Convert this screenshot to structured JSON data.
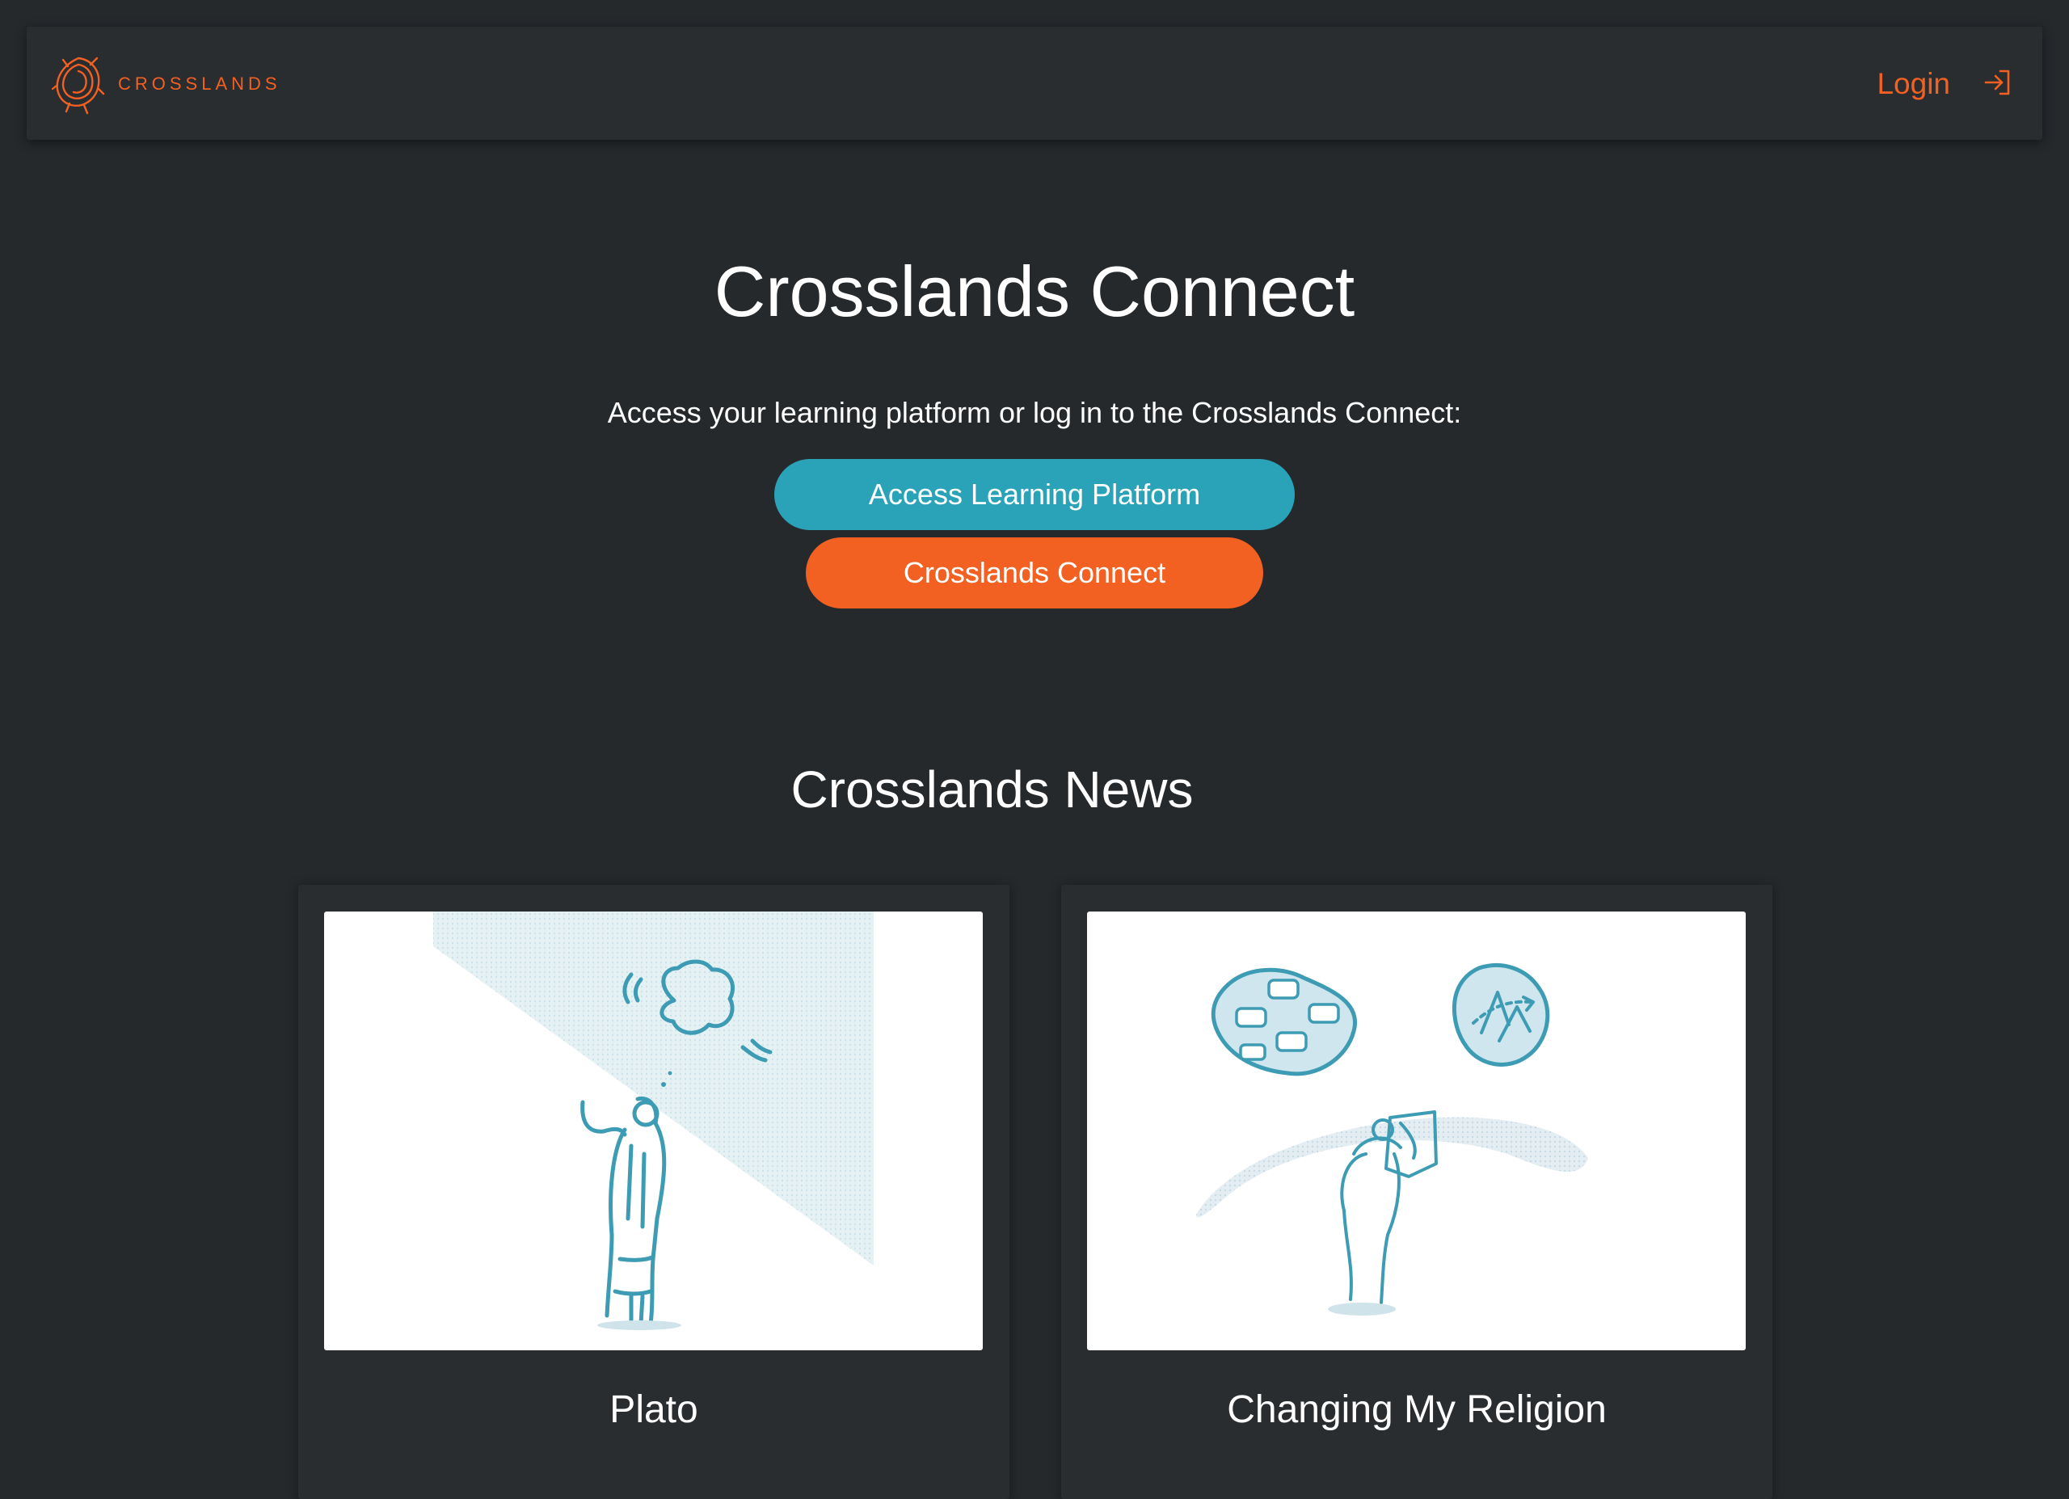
{
  "brand": {
    "name": "CROSSLANDS",
    "logo_icon": "crosslands-swirl-logo",
    "accent_color": "#f26022"
  },
  "nav": {
    "login_label": "Login",
    "login_icon": "sign-in-icon"
  },
  "hero": {
    "title": "Crosslands Connect",
    "subtitle": "Access your learning platform or log in to the Crosslands Connect:",
    "primary_button": "Access Learning Platform",
    "secondary_button": "Crosslands Connect",
    "primary_color": "#2aa3b9",
    "secondary_color": "#f26022"
  },
  "news": {
    "title": "Crosslands News",
    "articles": [
      {
        "title": "Plato",
        "image": "plato-statue-illustration"
      },
      {
        "title": "Changing My Religion",
        "image": "person-reading-map-illustration"
      }
    ]
  }
}
